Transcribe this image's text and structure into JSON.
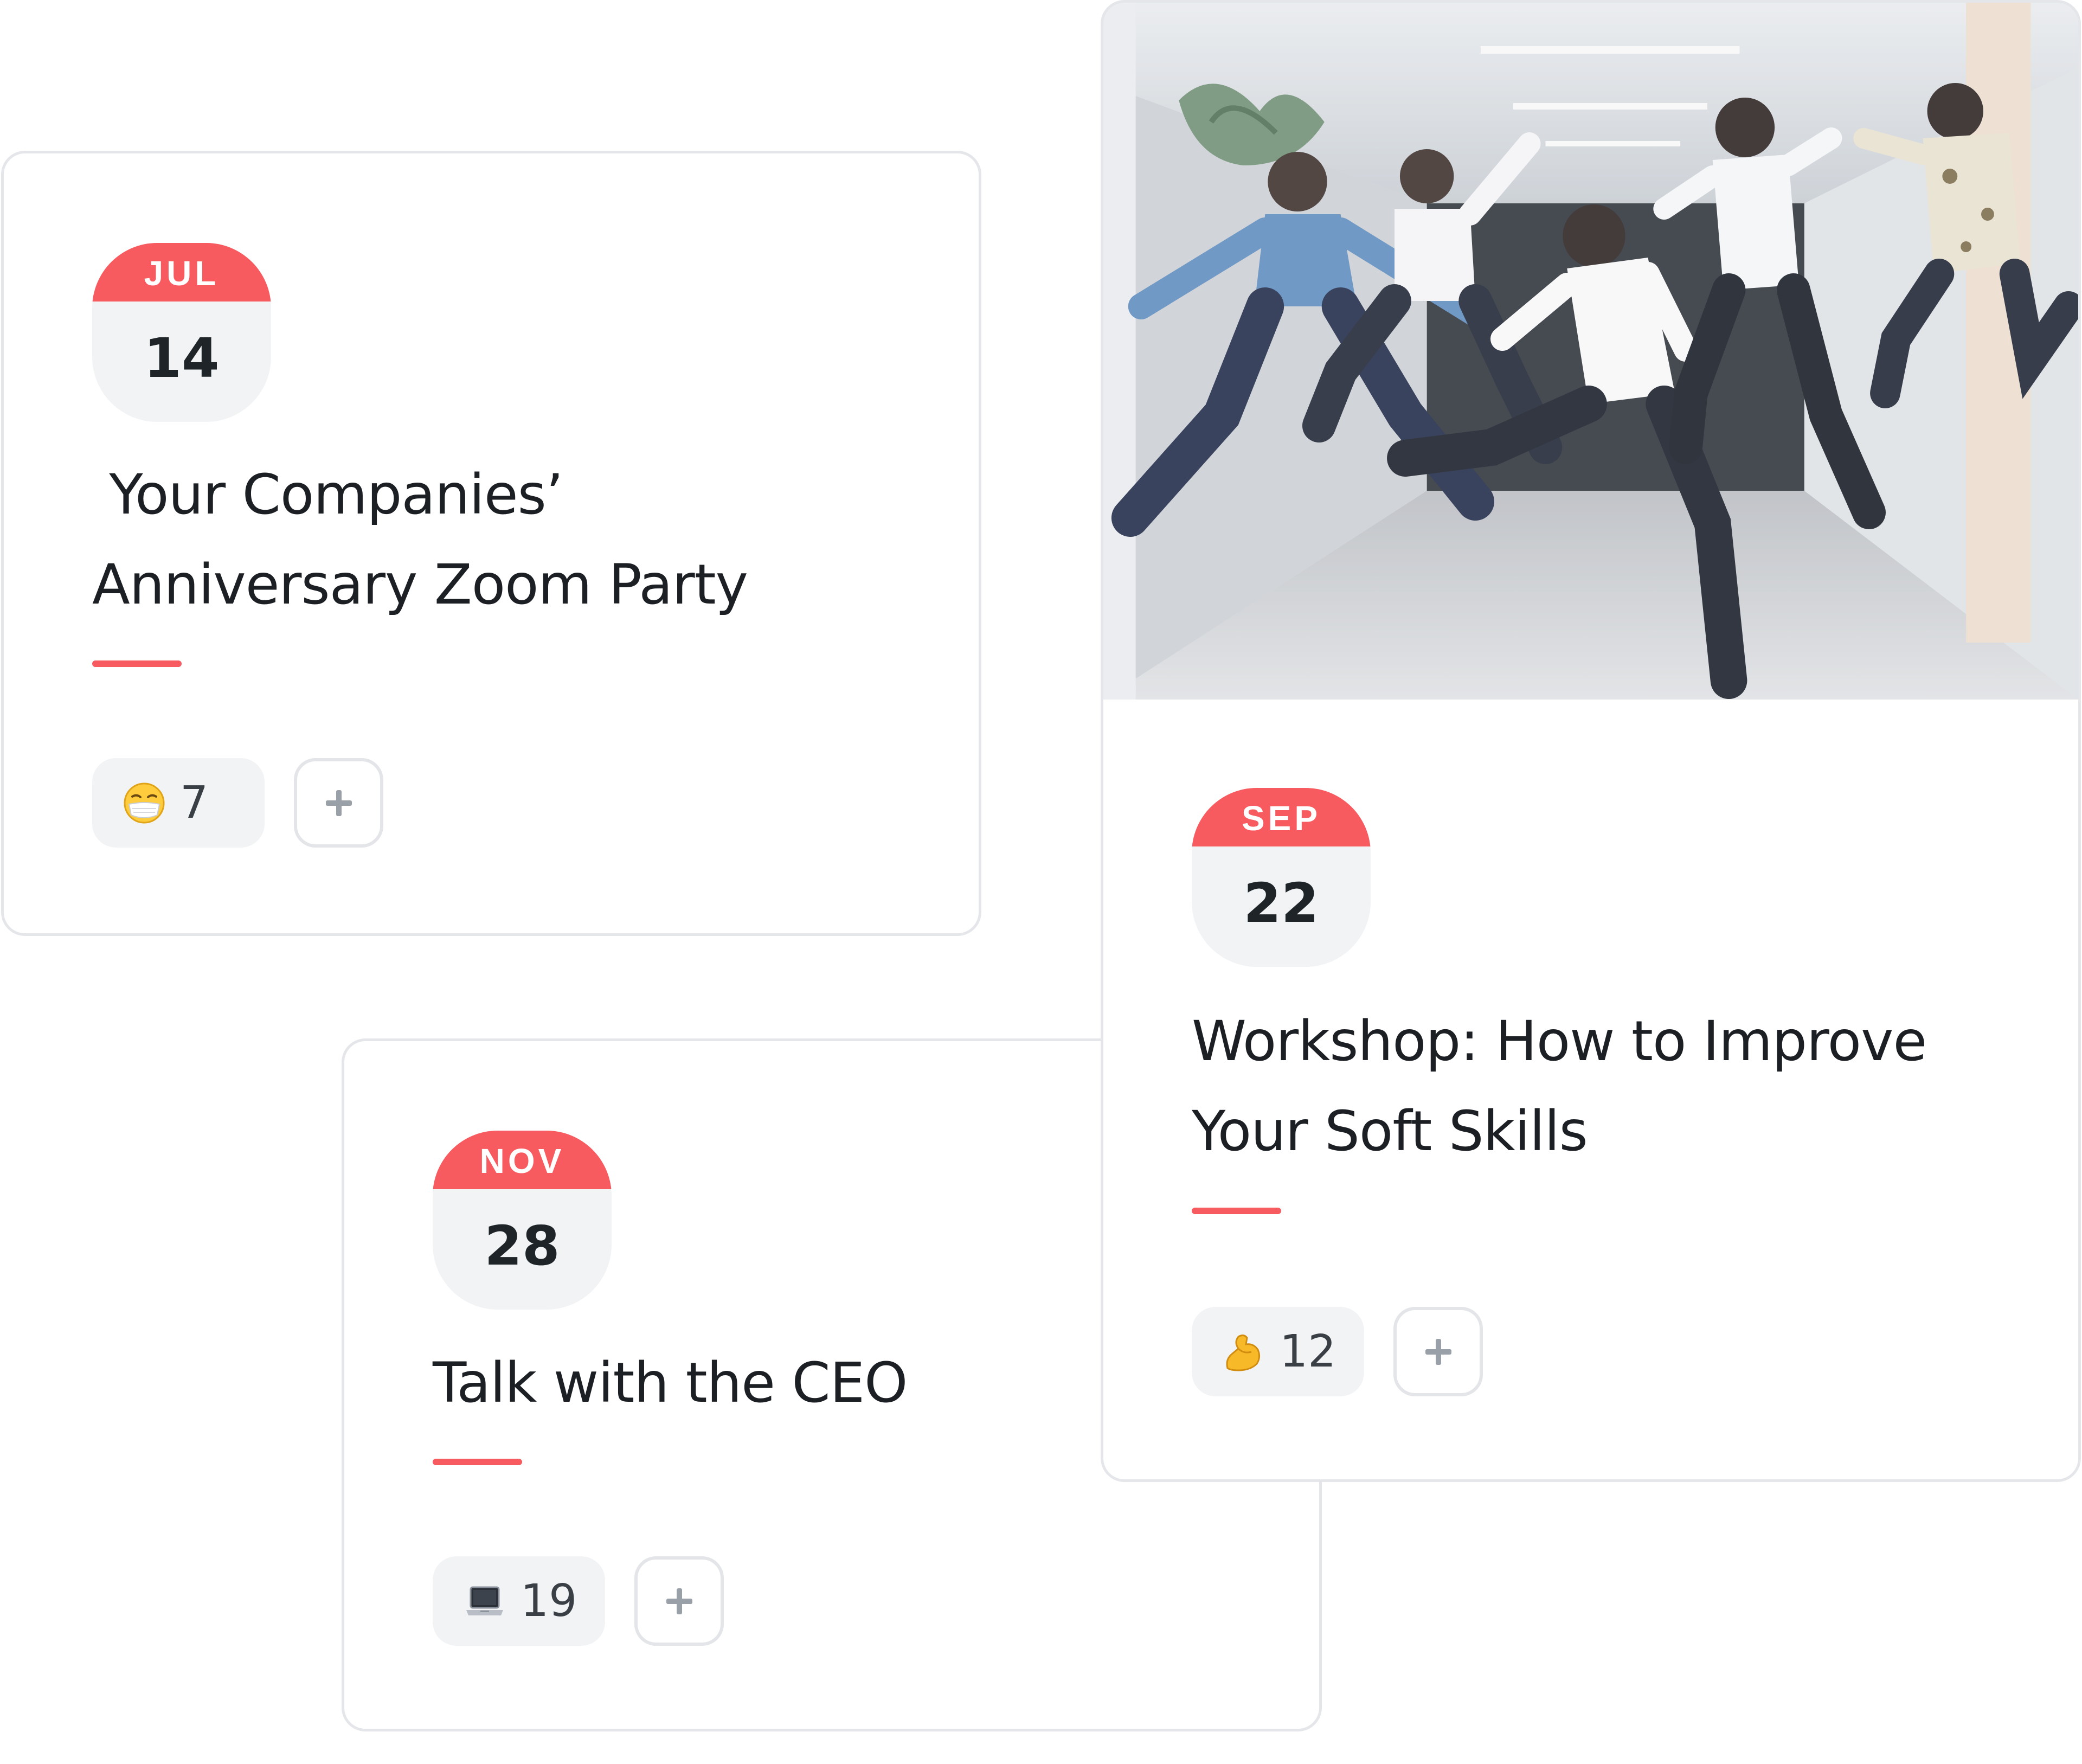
{
  "events": [
    {
      "id": "jul",
      "month": "JUL",
      "day": "14",
      "title": " Your Companies’\nAnniversary Zoom Party",
      "reaction": {
        "icon": "face-with-medical-mask-icon",
        "count": "7"
      },
      "add_icon": "plus-icon"
    },
    {
      "id": "nov",
      "month": "NOV",
      "day": "28",
      "title": "Talk with the CEO",
      "reaction": {
        "icon": "laptop-icon",
        "count": "19"
      },
      "add_icon": "plus-icon"
    },
    {
      "id": "sep",
      "month": "SEP",
      "day": "22",
      "title": "Workshop: How to Improve\nYour Soft Skills",
      "reaction": {
        "icon": "flexed-biceps-icon",
        "count": "12"
      },
      "add_icon": "plus-icon",
      "image": "people-jumping-in-hallway-photo"
    }
  ],
  "colors": {
    "accent": "#f75a5f",
    "calendar_body": "#f2f3f5",
    "card_border": "#e4e6ea",
    "text": "#1f2429"
  }
}
